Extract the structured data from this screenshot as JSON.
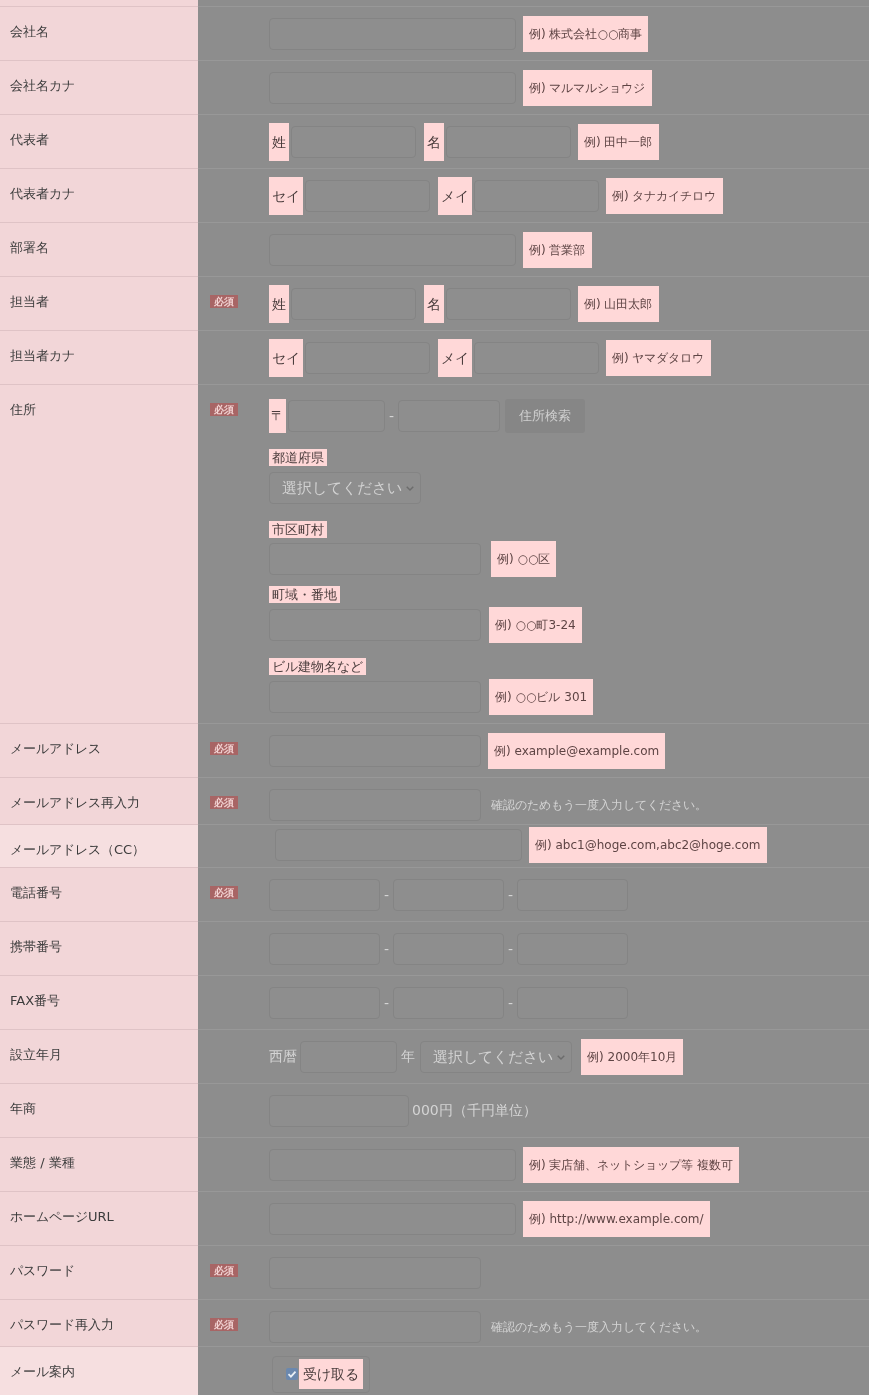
{
  "form": {
    "rows": [
      {
        "label": "会社名",
        "kind": "text",
        "hint": "例) 株式会社○○商事"
      },
      {
        "label": "会社名カナ",
        "kind": "text",
        "hint": "例) マルマルショウジ"
      },
      {
        "label": "代表者",
        "kind": "name",
        "prefixes": [
          "姓",
          "名"
        ],
        "hint": "例) 田中一郎"
      },
      {
        "label": "代表者カナ",
        "kind": "name",
        "prefixes": [
          "セイ",
          "メイ"
        ],
        "hint": "例) タナカイチロウ"
      },
      {
        "label": "部署名",
        "kind": "text",
        "hint": "例) 営業部"
      },
      {
        "label": "担当者",
        "badge": "必須",
        "kind": "name",
        "prefixes": [
          "姓",
          "名"
        ],
        "hint": "例) 山田太郎"
      },
      {
        "label": "担当者カナ",
        "kind": "name",
        "prefixes": [
          "セイ",
          "メイ"
        ],
        "hint": "例) ヤマダタロウ"
      },
      {
        "label": "住所",
        "badge": "必須",
        "kind": "address",
        "postal": {
          "mark": "〒",
          "separator": "-",
          "button": "住所検索"
        },
        "prefecture": {
          "label": "都道府県",
          "value": "選択してください"
        },
        "lines": [
          {
            "label": "市区町村",
            "hint": "例) ○○区"
          },
          {
            "label": "町域・番地",
            "hint": "例) ○○町3-24"
          },
          {
            "label": "ビル建物名など",
            "hint": "例) ○○ビル 301"
          }
        ]
      },
      {
        "label": "メールアドレス",
        "badge": "必須",
        "kind": "short-text",
        "hint": "例) example@example.com"
      },
      {
        "label": "メールアドレス再入力",
        "badge": "必須",
        "kind": "confirm",
        "note": "確認のためもう一度入力してください。"
      },
      {
        "label": "メールアドレス（CC）",
        "kind": "text",
        "highlighted": true,
        "hint": "例) abc1@hoge.com,abc2@hoge.com"
      },
      {
        "label": "電話番号",
        "badge": "必須",
        "kind": "phone",
        "separators": [
          "-",
          "-"
        ]
      },
      {
        "label": "携帯番号",
        "kind": "phone",
        "separators": [
          "-",
          "-"
        ]
      },
      {
        "label": "FAX番号",
        "kind": "phone",
        "separators": [
          "-",
          "-"
        ]
      },
      {
        "label": "設立年月",
        "kind": "date",
        "prefix": "西暦",
        "unit": "年",
        "month": "選択してください",
        "hint": "例) 2000年10月"
      },
      {
        "label": "年商",
        "kind": "amount",
        "suffix": "000円（千円単位）"
      },
      {
        "label": "業態 / 業種",
        "kind": "text",
        "hint": "例) 実店舗、ネットショップ等 複数可"
      },
      {
        "label": "ホームページURL",
        "kind": "text",
        "hint": "例) http://www.example.com/"
      },
      {
        "label": "パスワード",
        "badge": "必須",
        "kind": "short-text"
      },
      {
        "label": "パスワード再入力",
        "badge": "必須",
        "kind": "confirm",
        "note": "確認のためもう一度入力してください。"
      },
      {
        "label": "メール案内",
        "kind": "checkbox",
        "highlighted": true,
        "option": {
          "label": "受け取る",
          "checked": true
        }
      }
    ]
  }
}
